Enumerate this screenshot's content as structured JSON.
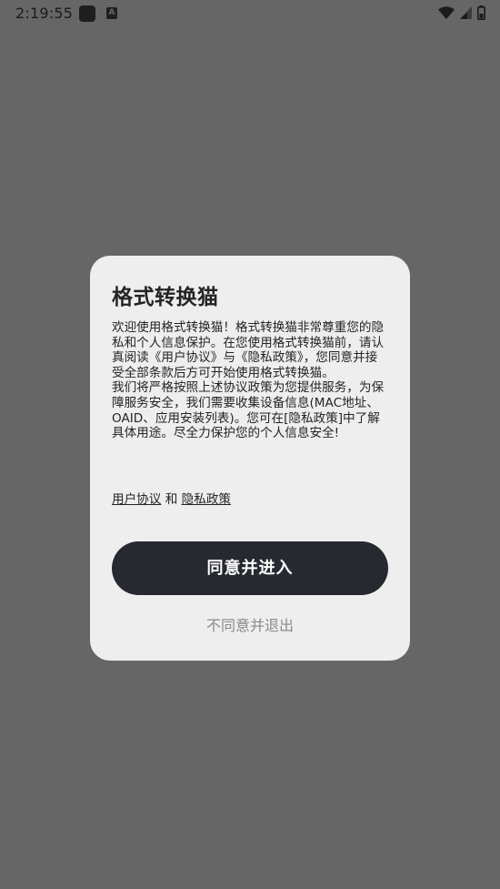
{
  "status_bar": {
    "time": "2:19:55",
    "a_icon_letter": "A"
  },
  "dialog": {
    "title": "格式转换猫",
    "body_paragraph_1": "欢迎使用格式转换猫！格式转换猫非常尊重您的隐私和个人信息保护。在您使用格式转换猫前，请认真阅读《用户协议》与《隐私政策》，您同意并接受全部条款后方可开始使用格式转换猫。",
    "body_paragraph_2": "我们将严格按照上述协议政策为您提供服务，为保障服务安全，我们需要收集设备信息(MAC地址、OAID、应用安装列表)。您可在[隐私政策]中了解具体用途。尽全力保护您的个人信息安全!",
    "link_user_agreement": "用户协议",
    "link_separator": " 和 ",
    "link_privacy_policy": "隐私政策",
    "agree_button": "同意并进入",
    "decline_button": "不同意并退出"
  }
}
